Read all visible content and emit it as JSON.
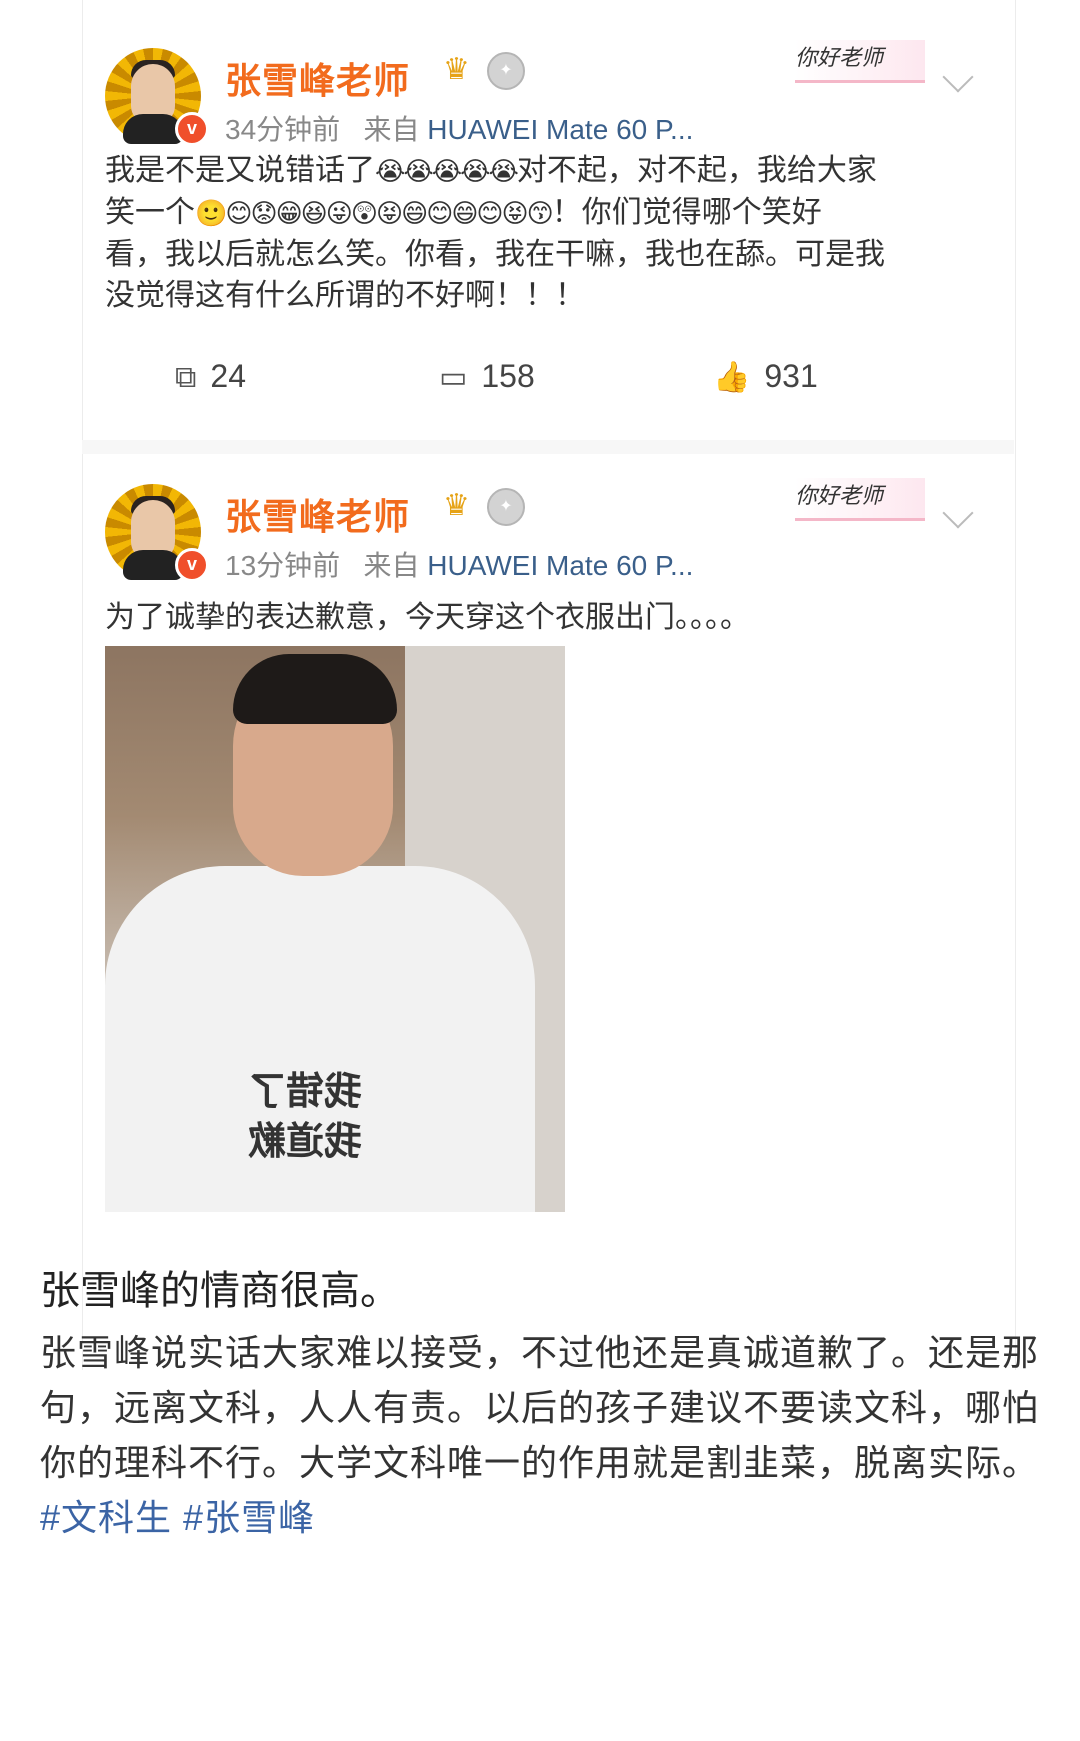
{
  "posts": [
    {
      "username": "张雪峰老师",
      "time": "34分钟前",
      "from_label": "来自",
      "source": "HUAWEI Mate 60 P...",
      "sticker_text": "你好老师",
      "verified_badge": "v",
      "text_line1": "我是不是又说错话了",
      "emoji_run1": "😭😭😭😭😭",
      "text_line1b": "对不起，对不起，我给大家",
      "text_line2a": "笑一个",
      "emoji_run2": "🙂😊😟😁😆😜😲😝😄😊😄😊😝😙",
      "text_line2b": "！你们觉得哪个笑好",
      "text_line3": "看，我以后就怎么笑。你看，我在干嘛，我也在舔。可是我",
      "text_line4": "没觉得这有什么所谓的不好啊！！！",
      "repost_count": "24",
      "comment_count": "158",
      "like_count": "931"
    },
    {
      "username": "张雪峰老师",
      "time": "13分钟前",
      "from_label": "来自",
      "source": "HUAWEI Mate 60 P...",
      "sticker_text": "你好老师",
      "verified_badge": "v",
      "text": "为了诚挚的表达歉意，今天穿这个衣服出门。。。。",
      "shirt_line1": "我错了",
      "shirt_line2": "我道歉"
    }
  ],
  "headline": "张雪峰的情商很高。",
  "paragraph": "张雪峰说实话大家难以接受，不过他还是真诚道歉了。还是那句，远离文科，人人有责。以后的孩子建议不要读文科，哪怕你的理科不行。大学文科唯一的作用就是割韭菜，脱离实际。",
  "hashtags": [
    "#文科生",
    "#张雪峰"
  ],
  "icons": {
    "repost": "repost-icon",
    "comment": "comment-icon",
    "like": "like-icon",
    "crown": "crown-icon",
    "medal": "medal-icon",
    "chevron": "chevron-down-icon"
  },
  "colors": {
    "username": "#f26b1d",
    "link": "#3b64a5",
    "verified": "#f04f2b"
  }
}
